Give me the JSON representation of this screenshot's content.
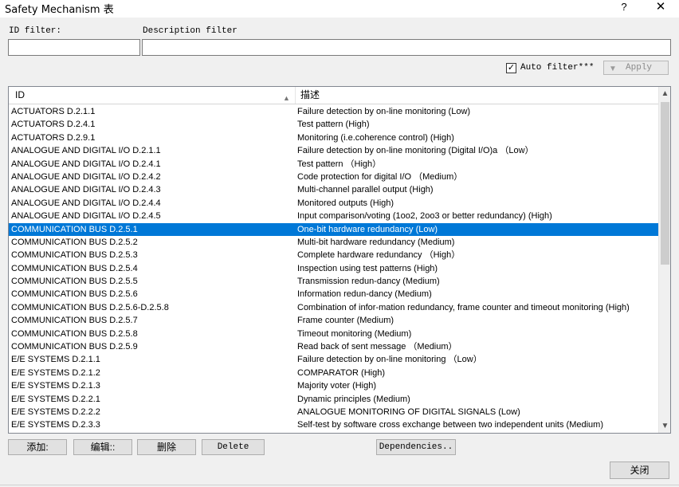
{
  "window": {
    "title": "Safety Mechanism 表",
    "help": "?",
    "close": "✕"
  },
  "filters": {
    "id_label": "ID filter:",
    "id_value": "",
    "desc_label": "Description filter",
    "desc_value": "",
    "auto_filter_label": "Auto filter***",
    "auto_filter_checked": "✓",
    "apply_label": "Apply"
  },
  "table": {
    "col_id": "ID",
    "col_desc": "描述",
    "selected_index": 9,
    "rows": [
      {
        "id": "ACTUATORS D.2.1.1",
        "desc": "Failure detection by on-line monitoring (Low)"
      },
      {
        "id": "ACTUATORS D.2.4.1",
        "desc": "Test pattern (High)"
      },
      {
        "id": "ACTUATORS D.2.9.1",
        "desc": "Monitoring (i.e.coherence control) (High)"
      },
      {
        "id": "ANALOGUE AND DIGITAL I/O D.2.1.1",
        "desc": "Failure detection by on-line monitoring (Digital I/O)a （Low）"
      },
      {
        "id": "ANALOGUE AND DIGITAL I/O D.2.4.1",
        "desc": "Test pattern （High）"
      },
      {
        "id": "ANALOGUE AND DIGITAL I/O D.2.4.2",
        "desc": "Code protection for digital I/O （Medium）"
      },
      {
        "id": "ANALOGUE AND DIGITAL I/O D.2.4.3",
        "desc": "Multi-channel parallel output (High)"
      },
      {
        "id": "ANALOGUE AND DIGITAL I/O D.2.4.4",
        "desc": "Monitored outputs (High)"
      },
      {
        "id": "ANALOGUE AND DIGITAL I/O D.2.4.5",
        "desc": "Input comparison/voting (1oo2, 2oo3 or better redundancy) (High)"
      },
      {
        "id": "COMMUNICATION BUS D.2.5.1",
        "desc": "One-bit hardware redundancy (Low)"
      },
      {
        "id": "COMMUNICATION BUS D.2.5.2",
        "desc": "Multi-bit hardware redundancy (Medium)"
      },
      {
        "id": "COMMUNICATION BUS D.2.5.3",
        "desc": "Complete hardware redundancy （High）"
      },
      {
        "id": "COMMUNICATION BUS D.2.5.4",
        "desc": "Inspection using test patterns (High)"
      },
      {
        "id": "COMMUNICATION BUS D.2.5.5",
        "desc": "Transmission redun-dancy (Medium)"
      },
      {
        "id": "COMMUNICATION BUS D.2.5.6",
        "desc": "Information redun-dancy (Medium)"
      },
      {
        "id": "COMMUNICATION BUS D.2.5.6-D.2.5.8",
        "desc": "Combination of infor-mation redundancy, frame counter and timeout monitoring (High)"
      },
      {
        "id": "COMMUNICATION BUS D.2.5.7",
        "desc": "Frame counter (Medium)"
      },
      {
        "id": "COMMUNICATION BUS D.2.5.8",
        "desc": "Timeout monitoring (Medium)"
      },
      {
        "id": "COMMUNICATION BUS D.2.5.9",
        "desc": "Read back of sent message （Medium）"
      },
      {
        "id": "E/E SYSTEMS D.2.1.1",
        "desc": "Failure detection by on-line monitoring （Low）"
      },
      {
        "id": "E/E SYSTEMS D.2.1.2",
        "desc": "COMPARATOR (High)"
      },
      {
        "id": "E/E SYSTEMS D.2.1.3",
        "desc": "Majority voter (High)"
      },
      {
        "id": "E/E SYSTEMS D.2.2.1",
        "desc": "Dynamic principles (Medium)"
      },
      {
        "id": "E/E SYSTEMS D.2.2.2",
        "desc": "ANALOGUE MONITORING OF DIGITAL SIGNALS (Low)"
      },
      {
        "id": "E/E SYSTEMS D.2.3.3",
        "desc": "Self-test by software cross exchange between two independent units (Medium)"
      }
    ]
  },
  "buttons": {
    "add": "添加:",
    "edit": "编辑::",
    "delete_cn": "删除",
    "delete": "Delete",
    "dependencies": "Dependencies..",
    "close": "关闭"
  }
}
